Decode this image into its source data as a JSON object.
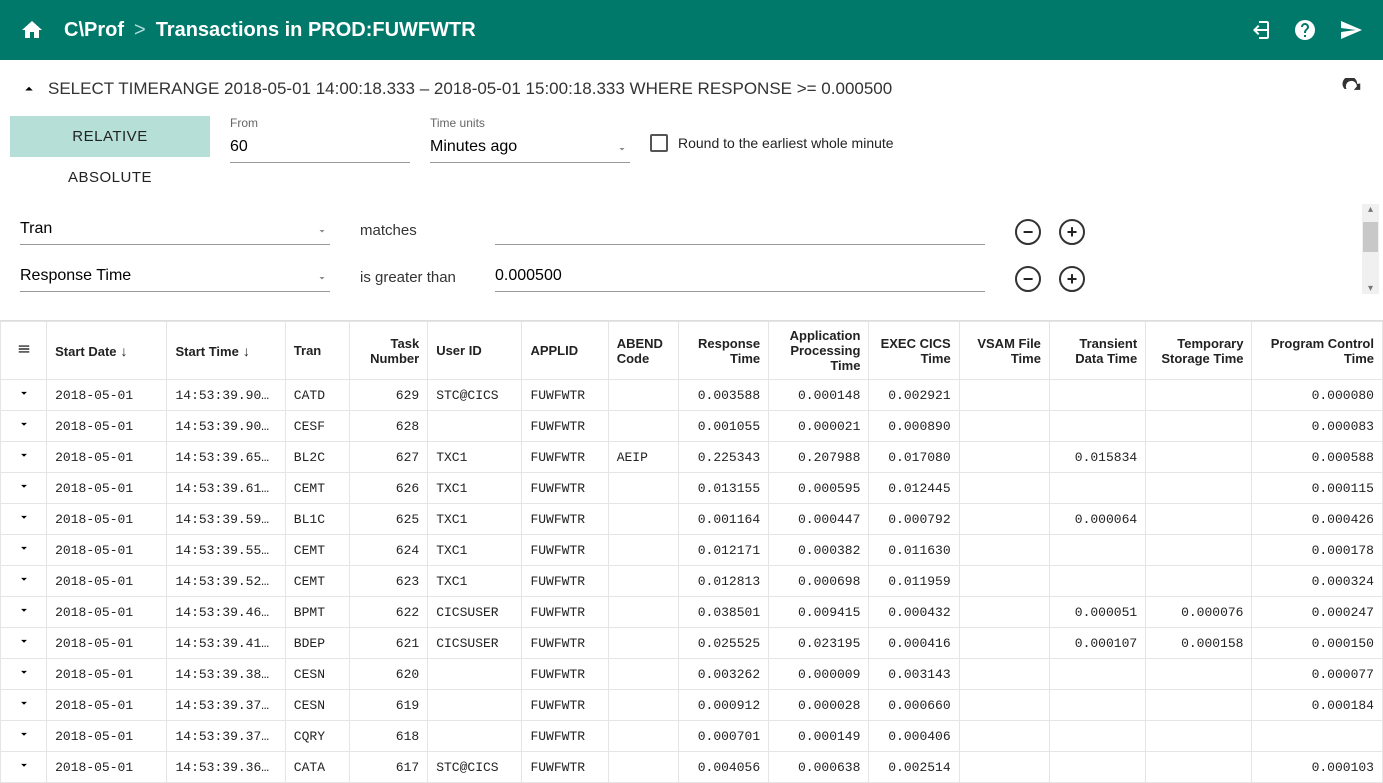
{
  "header": {
    "app": "C\\Prof",
    "title": "Transactions in PROD:FUWFWTR"
  },
  "query": {
    "summary": "SELECT TIMERANGE 2018-05-01 14:00:18.333 – 2018-05-01 15:00:18.333  WHERE  RESPONSE >= 0.000500"
  },
  "time": {
    "tab_relative": "RELATIVE",
    "tab_absolute": "ABSOLUTE",
    "from_label": "From",
    "from_value": "60",
    "units_label": "Time units",
    "units_value": "Minutes ago",
    "round_label": "Round to the earliest whole minute"
  },
  "filters": [
    {
      "field": "Tran",
      "op": "matches",
      "value": ""
    },
    {
      "field": "Response Time",
      "op": "is greater than",
      "value": "0.000500"
    }
  ],
  "columns": {
    "start_date": "Start Date",
    "start_time": "Start Time",
    "tran": "Tran",
    "task_number": "Task Number",
    "user_id": "User ID",
    "applid": "APPLID",
    "abend": "ABEND Code",
    "response": "Response Time",
    "proc": "Application Processing Time",
    "exec": "EXEC CICS Time",
    "vsam": "VSAM File Time",
    "td": "Transient Data Time",
    "ts": "Temporary Storage Time",
    "pc": "Program Control Time"
  },
  "rows": [
    {
      "date": "2018-05-01",
      "time": "14:53:39.90…",
      "tran": "CATD",
      "task": "629",
      "user": "STC@CICS",
      "applid": "FUWFWTR",
      "abend": "",
      "resp": "0.003588",
      "proc": "0.000148",
      "exec": "0.002921",
      "vsam": "",
      "td": "",
      "ts": "",
      "pc": "0.000080"
    },
    {
      "date": "2018-05-01",
      "time": "14:53:39.90…",
      "tran": "CESF",
      "task": "628",
      "user": "",
      "applid": "FUWFWTR",
      "abend": "",
      "resp": "0.001055",
      "proc": "0.000021",
      "exec": "0.000890",
      "vsam": "",
      "td": "",
      "ts": "",
      "pc": "0.000083"
    },
    {
      "date": "2018-05-01",
      "time": "14:53:39.65…",
      "tran": "BL2C",
      "task": "627",
      "user": "TXC1",
      "applid": "FUWFWTR",
      "abend": "AEIP",
      "resp": "0.225343",
      "proc": "0.207988",
      "exec": "0.017080",
      "vsam": "",
      "td": "0.015834",
      "ts": "",
      "pc": "0.000588"
    },
    {
      "date": "2018-05-01",
      "time": "14:53:39.61…",
      "tran": "CEMT",
      "task": "626",
      "user": "TXC1",
      "applid": "FUWFWTR",
      "abend": "",
      "resp": "0.013155",
      "proc": "0.000595",
      "exec": "0.012445",
      "vsam": "",
      "td": "",
      "ts": "",
      "pc": "0.000115"
    },
    {
      "date": "2018-05-01",
      "time": "14:53:39.59…",
      "tran": "BL1C",
      "task": "625",
      "user": "TXC1",
      "applid": "FUWFWTR",
      "abend": "",
      "resp": "0.001164",
      "proc": "0.000447",
      "exec": "0.000792",
      "vsam": "",
      "td": "0.000064",
      "ts": "",
      "pc": "0.000426"
    },
    {
      "date": "2018-05-01",
      "time": "14:53:39.55…",
      "tran": "CEMT",
      "task": "624",
      "user": "TXC1",
      "applid": "FUWFWTR",
      "abend": "",
      "resp": "0.012171",
      "proc": "0.000382",
      "exec": "0.011630",
      "vsam": "",
      "td": "",
      "ts": "",
      "pc": "0.000178"
    },
    {
      "date": "2018-05-01",
      "time": "14:53:39.52…",
      "tran": "CEMT",
      "task": "623",
      "user": "TXC1",
      "applid": "FUWFWTR",
      "abend": "",
      "resp": "0.012813",
      "proc": "0.000698",
      "exec": "0.011959",
      "vsam": "",
      "td": "",
      "ts": "",
      "pc": "0.000324"
    },
    {
      "date": "2018-05-01",
      "time": "14:53:39.46…",
      "tran": "BPMT",
      "task": "622",
      "user": "CICSUSER",
      "applid": "FUWFWTR",
      "abend": "",
      "resp": "0.038501",
      "proc": "0.009415",
      "exec": "0.000432",
      "vsam": "",
      "td": "0.000051",
      "ts": "0.000076",
      "pc": "0.000247"
    },
    {
      "date": "2018-05-01",
      "time": "14:53:39.41…",
      "tran": "BDEP",
      "task": "621",
      "user": "CICSUSER",
      "applid": "FUWFWTR",
      "abend": "",
      "resp": "0.025525",
      "proc": "0.023195",
      "exec": "0.000416",
      "vsam": "",
      "td": "0.000107",
      "ts": "0.000158",
      "pc": "0.000150"
    },
    {
      "date": "2018-05-01",
      "time": "14:53:39.38…",
      "tran": "CESN",
      "task": "620",
      "user": "",
      "applid": "FUWFWTR",
      "abend": "",
      "resp": "0.003262",
      "proc": "0.000009",
      "exec": "0.003143",
      "vsam": "",
      "td": "",
      "ts": "",
      "pc": "0.000077"
    },
    {
      "date": "2018-05-01",
      "time": "14:53:39.37…",
      "tran": "CESN",
      "task": "619",
      "user": "",
      "applid": "FUWFWTR",
      "abend": "",
      "resp": "0.000912",
      "proc": "0.000028",
      "exec": "0.000660",
      "vsam": "",
      "td": "",
      "ts": "",
      "pc": "0.000184"
    },
    {
      "date": "2018-05-01",
      "time": "14:53:39.37…",
      "tran": "CQRY",
      "task": "618",
      "user": "",
      "applid": "FUWFWTR",
      "abend": "",
      "resp": "0.000701",
      "proc": "0.000149",
      "exec": "0.000406",
      "vsam": "",
      "td": "",
      "ts": "",
      "pc": ""
    },
    {
      "date": "2018-05-01",
      "time": "14:53:39.36…",
      "tran": "CATA",
      "task": "617",
      "user": "STC@CICS",
      "applid": "FUWFWTR",
      "abend": "",
      "resp": "0.004056",
      "proc": "0.000638",
      "exec": "0.002514",
      "vsam": "",
      "td": "",
      "ts": "",
      "pc": "0.000103"
    }
  ]
}
